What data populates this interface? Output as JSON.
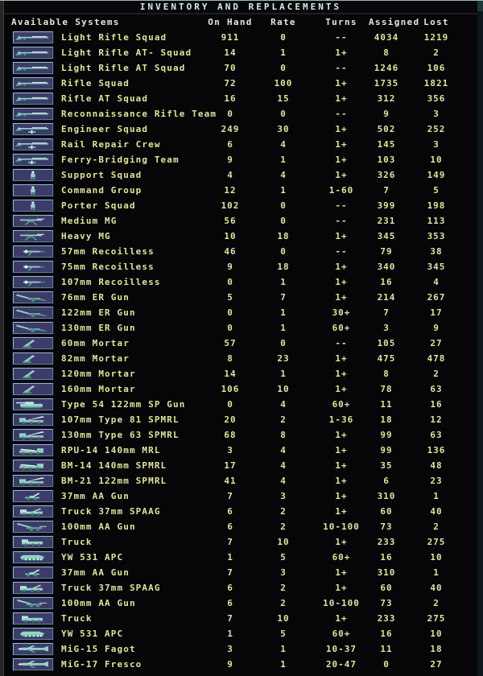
{
  "title": "INVENTORY AND REPLACEMENTS",
  "colors": {
    "background": "#060608",
    "title_text": "#d8eae8",
    "header_text": "#e6e6dc",
    "data_text": "#e2e2a0",
    "button_face": "#3c3c6a",
    "button_border_light": "#9ab6c2",
    "glyph_teal": "#96d4c6"
  },
  "table": {
    "columns": [
      "Available Systems",
      "On Hand",
      "Rate",
      "Turns",
      "Assigned",
      "Lost"
    ],
    "rows": [
      {
        "icon": "rifle-icon",
        "name": "Light Rifle Squad",
        "on_hand": "911",
        "rate": "0",
        "turns": "--",
        "assigned": "4034",
        "lost": "1219"
      },
      {
        "icon": "rifle-icon",
        "name": "Light Rifle AT- Squad",
        "on_hand": "14",
        "rate": "1",
        "turns": "1+",
        "assigned": "8",
        "lost": "2"
      },
      {
        "icon": "rifle-icon",
        "name": "Light Rifle AT Squad",
        "on_hand": "70",
        "rate": "0",
        "turns": "--",
        "assigned": "1246",
        "lost": "106"
      },
      {
        "icon": "rifle-icon",
        "name": "Rifle Squad",
        "on_hand": "72",
        "rate": "100",
        "turns": "1+",
        "assigned": "1735",
        "lost": "1821"
      },
      {
        "icon": "rifle-icon",
        "name": "Rifle AT Squad",
        "on_hand": "16",
        "rate": "15",
        "turns": "1+",
        "assigned": "312",
        "lost": "356"
      },
      {
        "icon": "rifle-icon",
        "name": "Reconnaissance Rifle Team",
        "on_hand": "0",
        "rate": "0",
        "turns": "--",
        "assigned": "9",
        "lost": "3"
      },
      {
        "icon": "engineer-rifle-icon",
        "name": "Engineer Squad",
        "on_hand": "249",
        "rate": "30",
        "turns": "1+",
        "assigned": "502",
        "lost": "252"
      },
      {
        "icon": "engineer-rifle-icon",
        "name": "Rail Repair Crew",
        "on_hand": "6",
        "rate": "4",
        "turns": "1+",
        "assigned": "145",
        "lost": "3"
      },
      {
        "icon": "engineer-rifle-icon",
        "name": "Ferry-Bridging Team",
        "on_hand": "9",
        "rate": "1",
        "turns": "1+",
        "assigned": "103",
        "lost": "10"
      },
      {
        "icon": "infantry-icon",
        "name": "Support Squad",
        "on_hand": "4",
        "rate": "4",
        "turns": "1+",
        "assigned": "326",
        "lost": "149"
      },
      {
        "icon": "infantry-icon",
        "name": "Command Group",
        "on_hand": "12",
        "rate": "1",
        "turns": "1-60",
        "assigned": "7",
        "lost": "5"
      },
      {
        "icon": "infantry-icon",
        "name": "Porter Squad",
        "on_hand": "102",
        "rate": "0",
        "turns": "--",
        "assigned": "399",
        "lost": "198"
      },
      {
        "icon": "machine-gun-icon",
        "name": "Medium MG",
        "on_hand": "56",
        "rate": "0",
        "turns": "--",
        "assigned": "231",
        "lost": "113"
      },
      {
        "icon": "machine-gun-icon",
        "name": "Heavy MG",
        "on_hand": "10",
        "rate": "18",
        "turns": "1+",
        "assigned": "345",
        "lost": "353"
      },
      {
        "icon": "recoilless-gun-icon",
        "name": "57mm Recoilless",
        "on_hand": "46",
        "rate": "0",
        "turns": "--",
        "assigned": "79",
        "lost": "38"
      },
      {
        "icon": "recoilless-gun-icon",
        "name": "75mm Recoilless",
        "on_hand": "9",
        "rate": "18",
        "turns": "1+",
        "assigned": "340",
        "lost": "345"
      },
      {
        "icon": "recoilless-gun-icon",
        "name": "107mm Recoilless",
        "on_hand": "0",
        "rate": "1",
        "turns": "1+",
        "assigned": "16",
        "lost": "4"
      },
      {
        "icon": "field-gun-icon",
        "name": "76mm ER Gun",
        "on_hand": "5",
        "rate": "7",
        "turns": "1+",
        "assigned": "214",
        "lost": "267"
      },
      {
        "icon": "field-gun-icon",
        "name": "122mm ER Gun",
        "on_hand": "0",
        "rate": "1",
        "turns": "30+",
        "assigned": "7",
        "lost": "17"
      },
      {
        "icon": "field-gun-icon",
        "name": "130mm ER Gun",
        "on_hand": "0",
        "rate": "1",
        "turns": "60+",
        "assigned": "3",
        "lost": "9"
      },
      {
        "icon": "mortar-icon",
        "name": "60mm Mortar",
        "on_hand": "57",
        "rate": "0",
        "turns": "--",
        "assigned": "105",
        "lost": "27"
      },
      {
        "icon": "mortar-icon",
        "name": "82mm Mortar",
        "on_hand": "8",
        "rate": "23",
        "turns": "1+",
        "assigned": "475",
        "lost": "478"
      },
      {
        "icon": "mortar-icon",
        "name": "120mm Mortar",
        "on_hand": "14",
        "rate": "1",
        "turns": "1+",
        "assigned": "8",
        "lost": "2"
      },
      {
        "icon": "mortar-icon",
        "name": "160mm Mortar",
        "on_hand": "106",
        "rate": "10",
        "turns": "1+",
        "assigned": "78",
        "lost": "63"
      },
      {
        "icon": "sp-gun-icon",
        "name": "Type 54 122mm SP Gun",
        "on_hand": "0",
        "rate": "4",
        "turns": "60+",
        "assigned": "11",
        "lost": "16"
      },
      {
        "icon": "rocket-truck-icon",
        "name": "107mm Type 81 SPMRL",
        "on_hand": "20",
        "rate": "2",
        "turns": "1-36",
        "assigned": "18",
        "lost": "12"
      },
      {
        "icon": "rocket-truck-icon",
        "name": "130mm Type 63 SPMRL",
        "on_hand": "68",
        "rate": "8",
        "turns": "1+",
        "assigned": "99",
        "lost": "63"
      },
      {
        "icon": "mrl-truck-icon",
        "name": "RPU-14 140mm MRL",
        "on_hand": "3",
        "rate": "4",
        "turns": "1+",
        "assigned": "99",
        "lost": "136"
      },
      {
        "icon": "mrl-truck-icon",
        "name": "BM-14 140mm SPMRL",
        "on_hand": "17",
        "rate": "4",
        "turns": "1+",
        "assigned": "35",
        "lost": "48"
      },
      {
        "icon": "rocket-truck-icon",
        "name": "BM-21 122mm SPMRL",
        "on_hand": "41",
        "rate": "4",
        "turns": "1+",
        "assigned": "6",
        "lost": "23"
      },
      {
        "icon": "aa-gun-icon",
        "name": "37mm AA Gun",
        "on_hand": "7",
        "rate": "3",
        "turns": "1+",
        "assigned": "310",
        "lost": "1"
      },
      {
        "icon": "spaag-icon",
        "name": "Truck 37mm SPAAG",
        "on_hand": "6",
        "rate": "2",
        "turns": "1+",
        "assigned": "60",
        "lost": "40"
      },
      {
        "icon": "heavy-aa-gun-icon",
        "name": "100mm AA Gun",
        "on_hand": "6",
        "rate": "2",
        "turns": "10-100",
        "assigned": "73",
        "lost": "2"
      },
      {
        "icon": "truck-icon",
        "name": "Truck",
        "on_hand": "7",
        "rate": "10",
        "turns": "1+",
        "assigned": "233",
        "lost": "275"
      },
      {
        "icon": "apc-icon",
        "name": "YW 531 APC",
        "on_hand": "1",
        "rate": "5",
        "turns": "60+",
        "assigned": "16",
        "lost": "10"
      },
      {
        "icon": "aa-gun-icon",
        "name": "37mm AA Gun",
        "on_hand": "7",
        "rate": "3",
        "turns": "1+",
        "assigned": "310",
        "lost": "1"
      },
      {
        "icon": "spaag-icon",
        "name": "Truck 37mm SPAAG",
        "on_hand": "6",
        "rate": "2",
        "turns": "1+",
        "assigned": "60",
        "lost": "40"
      },
      {
        "icon": "heavy-aa-gun-icon",
        "name": "100mm AA Gun",
        "on_hand": "6",
        "rate": "2",
        "turns": "10-100",
        "assigned": "73",
        "lost": "2"
      },
      {
        "icon": "truck-icon",
        "name": "Truck",
        "on_hand": "7",
        "rate": "10",
        "turns": "1+",
        "assigned": "233",
        "lost": "275"
      },
      {
        "icon": "apc-icon",
        "name": "YW 531 APC",
        "on_hand": "1",
        "rate": "5",
        "turns": "60+",
        "assigned": "16",
        "lost": "10"
      },
      {
        "icon": "jet-icon",
        "name": "MiG-15 Fagot",
        "on_hand": "3",
        "rate": "1",
        "turns": "10-37",
        "assigned": "11",
        "lost": "18"
      },
      {
        "icon": "jet-icon",
        "name": "MiG-17 Fresco",
        "on_hand": "9",
        "rate": "1",
        "turns": "20-47",
        "assigned": "0",
        "lost": "27"
      }
    ]
  }
}
